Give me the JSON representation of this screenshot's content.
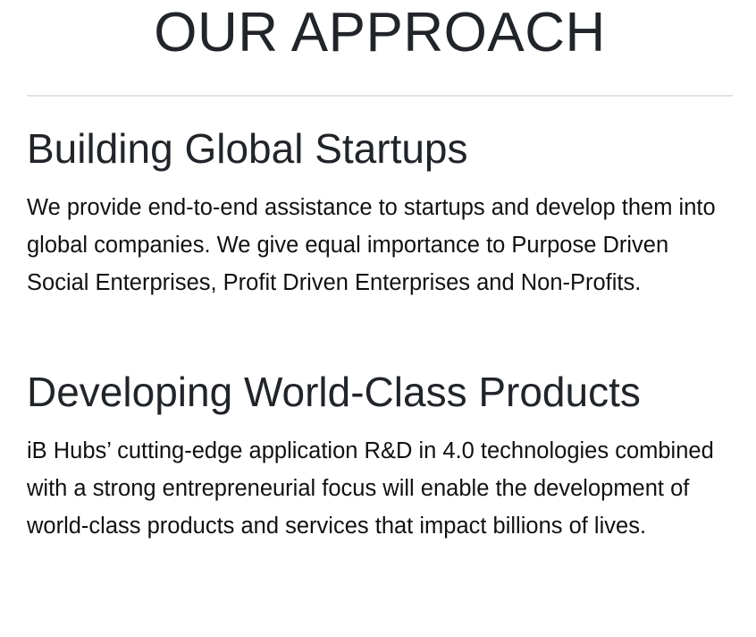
{
  "page": {
    "title": "OUR APPROACH"
  },
  "sections": [
    {
      "heading": "Building Global Startups",
      "body": "We provide end-to-end assistance to startups and develop them into global companies. We give equal importance to Purpose Driven Social Enterprises, Profit Driven Enterprises and Non-Profits."
    },
    {
      "heading": "Developing World-Class Products",
      "body": "iB Hubs’ cutting-edge application R&D in 4.0 technologies combined with a strong entrepreneurial focus will enable the development of world-class products and services that impact billions of lives."
    }
  ]
}
